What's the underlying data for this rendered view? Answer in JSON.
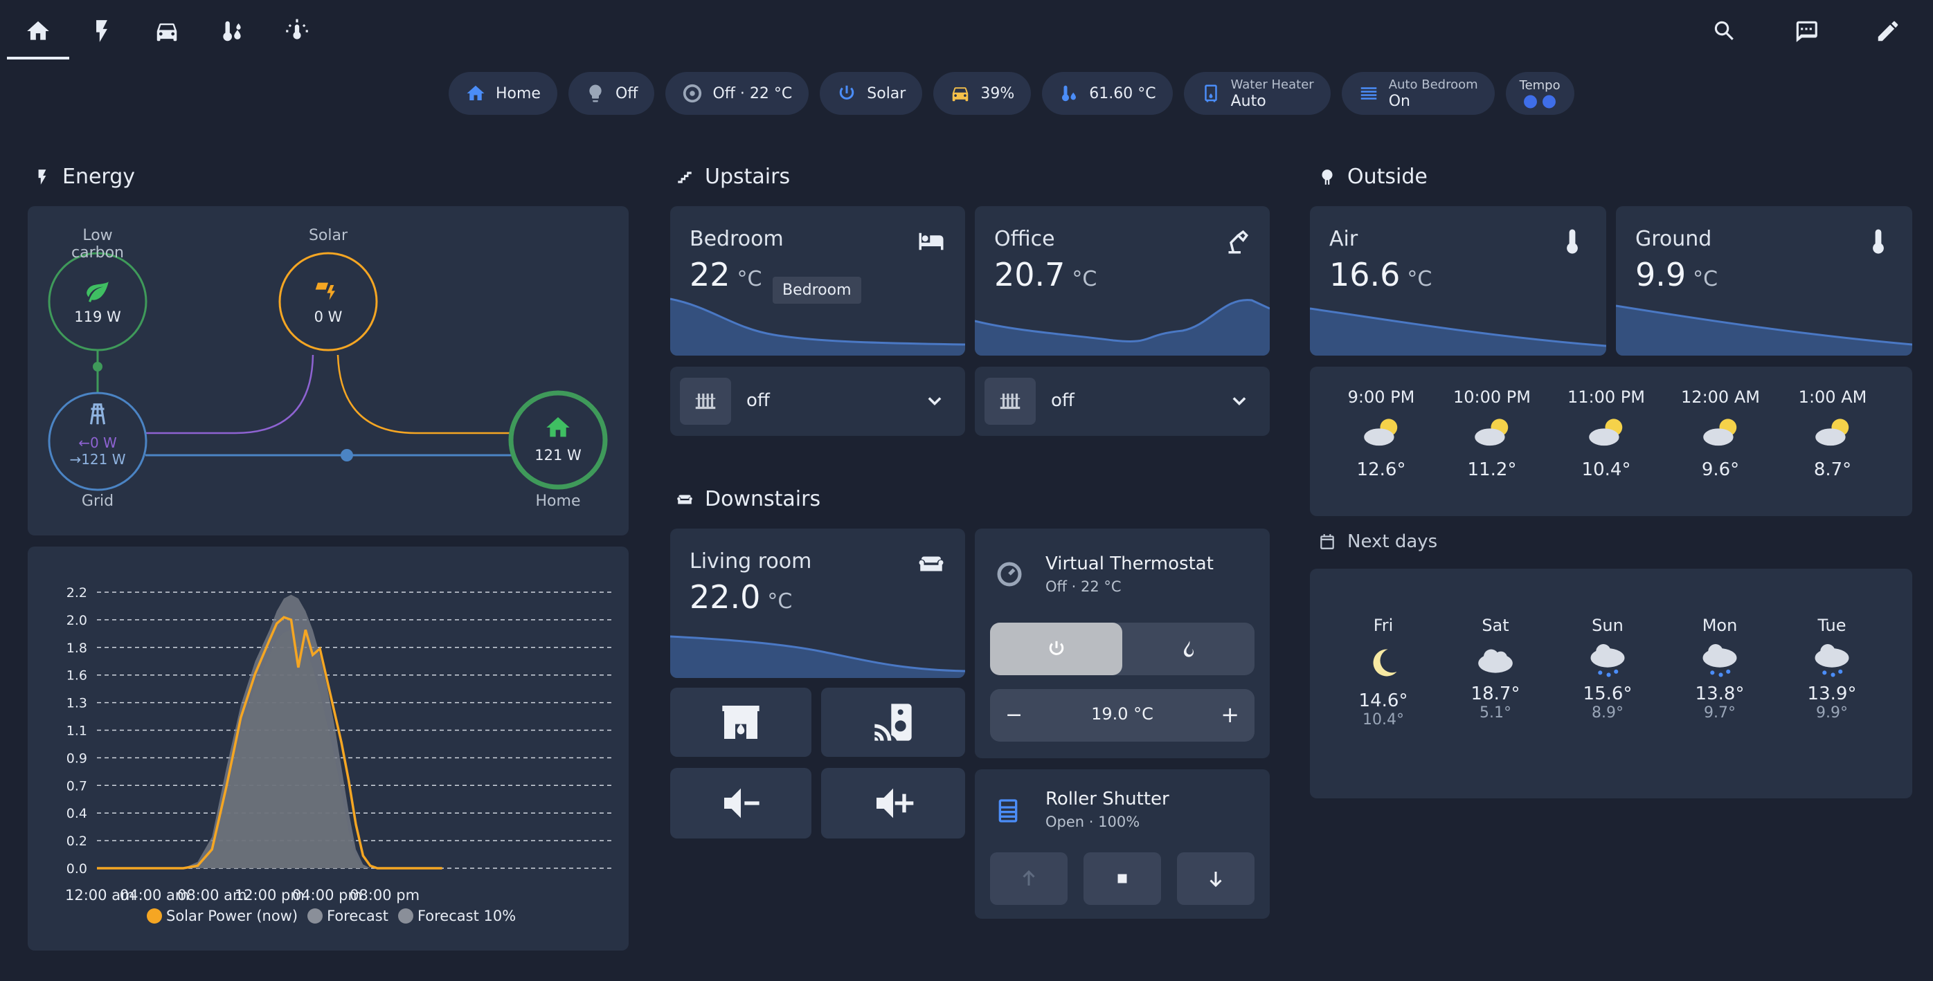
{
  "tabs": [
    "home-icon",
    "flash-icon",
    "car-icon",
    "thermometer-water-icon",
    "sun-thermometer-icon"
  ],
  "actions": [
    "search-icon",
    "chat-icon",
    "pencil-icon"
  ],
  "chips": [
    {
      "label": "Home",
      "icon": "home-icon",
      "color": "#4b8df8"
    },
    {
      "label": "Off",
      "icon": "bulb-icon",
      "color": "#9aa6b8"
    },
    {
      "label": "Off · 22 °C",
      "icon": "thermostat-icon",
      "color": "#9aa6b8"
    },
    {
      "label": "Solar",
      "icon": "power-icon",
      "color": "#4b8df8"
    },
    {
      "label": "39%",
      "icon": "car-icon",
      "color": "#f5c04a"
    },
    {
      "label": "61.60 °C",
      "icon": "thermometer-water-icon",
      "color": "#4b8df8"
    },
    {
      "sub": "Water Heater",
      "value": "Auto",
      "icon": "water-heater-icon",
      "color": "#4b8df8"
    },
    {
      "sub": "Auto Bedroom",
      "value": "On",
      "icon": "radiator-icon",
      "color": "#4b8df8"
    },
    {
      "sub": "Tempo",
      "icon": "tempo-dots-icon",
      "color": "#3f6ee8"
    }
  ],
  "energy": {
    "title": "Energy",
    "low_carbon": {
      "label": "Low carbon",
      "value": "119 W"
    },
    "solar": {
      "label": "Solar",
      "value": "0 W"
    },
    "grid": {
      "label": "Grid",
      "in": "←0 W",
      "out": "→121 W"
    },
    "home": {
      "label": "Home",
      "value": "121 W"
    }
  },
  "chart_data": {
    "type": "area",
    "title": "",
    "xlabel": "",
    "ylabel": "",
    "categories": [
      "12:00 am",
      "04:00 am",
      "08:00 am",
      "12:00 pm",
      "04:00 pm",
      "08:00 pm"
    ],
    "ylim": [
      0,
      2.2
    ],
    "yticks": [
      "0.0",
      "0.2",
      "0.4",
      "0.7",
      "0.9",
      "1.1",
      "1.3",
      "1.6",
      "1.8",
      "2.0",
      "2.2"
    ],
    "grid": true,
    "legend_placement": "bottom",
    "x_hours": [
      0,
      4,
      6,
      7,
      8,
      9,
      10,
      11,
      12,
      12.5,
      13,
      13.5,
      14,
      14.5,
      15,
      15.5,
      16,
      16.5,
      17,
      17.5,
      18,
      18.5,
      19,
      19.5,
      20,
      22,
      24
    ],
    "series": [
      {
        "name": "Solar Power (now)",
        "color": "#f5a623",
        "values": [
          0,
          0,
          0,
          0.02,
          0.15,
          0.65,
          1.2,
          1.55,
          1.82,
          1.95,
          2.0,
          1.98,
          1.6,
          1.9,
          1.7,
          1.75,
          1.5,
          1.25,
          1.0,
          0.7,
          0.35,
          0.1,
          0.02,
          0,
          0,
          0,
          0
        ]
      },
      {
        "name": "Forecast",
        "color": "#8a8f99",
        "values": [
          0,
          0,
          0,
          0.05,
          0.25,
          0.8,
          1.3,
          1.65,
          1.9,
          2.05,
          2.15,
          2.18,
          2.15,
          2.05,
          1.9,
          1.7,
          1.45,
          1.15,
          0.8,
          0.45,
          0.15,
          0.03,
          0,
          0,
          0,
          0,
          0
        ]
      },
      {
        "name": "Forecast 10%",
        "color": "#666b73",
        "values": [
          0,
          0,
          0,
          0.03,
          0.18,
          0.6,
          1.1,
          1.45,
          1.7,
          1.82,
          1.88,
          1.9,
          1.85,
          1.75,
          1.6,
          1.4,
          1.15,
          0.9,
          0.6,
          0.3,
          0.1,
          0.02,
          0,
          0,
          0,
          0,
          0
        ]
      }
    ]
  },
  "upstairs": {
    "title": "Upstairs",
    "bedroom": {
      "name": "Bedroom",
      "value": "22",
      "unit": "°C",
      "tooltip": "Bedroom",
      "hvac": "off"
    },
    "office": {
      "name": "Office",
      "value": "20.7",
      "unit": "°C",
      "hvac": "off"
    }
  },
  "downstairs": {
    "title": "Downstairs",
    "living": {
      "name": "Living room",
      "value": "22.0",
      "unit": "°C"
    }
  },
  "thermostat": {
    "name": "Virtual Thermostat",
    "state": "Off · 22 °C",
    "target": "19.0 °C",
    "minus": "−",
    "plus": "+"
  },
  "shutter": {
    "name": "Roller Shutter",
    "state": "Open · 100%"
  },
  "outside": {
    "title": "Outside",
    "air": {
      "name": "Air",
      "value": "16.6",
      "unit": "°C"
    },
    "ground": {
      "name": "Ground",
      "value": "9.9",
      "unit": "°C"
    }
  },
  "hourly": [
    {
      "time": "9:00 PM",
      "temp": "12.6°"
    },
    {
      "time": "10:00 PM",
      "temp": "11.2°"
    },
    {
      "time": "11:00 PM",
      "temp": "10.4°"
    },
    {
      "time": "12:00 AM",
      "temp": "9.6°"
    },
    {
      "time": "1:00 AM",
      "temp": "8.7°"
    }
  ],
  "next_days_title": "Next days",
  "daily": [
    {
      "day": "Fri",
      "high": "14.6°",
      "low": "10.4°",
      "icon": "moon-icon"
    },
    {
      "day": "Sat",
      "high": "18.7°",
      "low": "5.1°",
      "icon": "cloudy-icon"
    },
    {
      "day": "Sun",
      "high": "15.6°",
      "low": "8.9°",
      "icon": "rainy-icon"
    },
    {
      "day": "Mon",
      "high": "13.8°",
      "low": "9.7°",
      "icon": "rainy-icon"
    },
    {
      "day": "Tue",
      "high": "13.9°",
      "low": "9.9°",
      "icon": "rainy-icon"
    }
  ]
}
